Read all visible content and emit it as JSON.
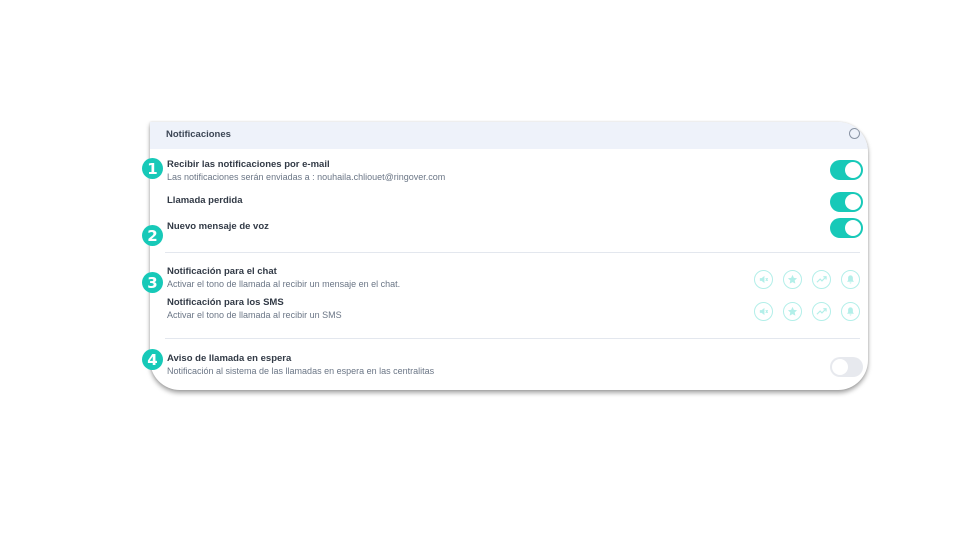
{
  "panel": {
    "title": "Notificaciones"
  },
  "email_notifications": {
    "title": "Recibir las notificaciones por e-mail",
    "subtitle": "Las notificaciones serán enviadas a : nouhaila.chliouet@ringover.com",
    "enabled": true
  },
  "missed_call": {
    "title": "Llamada perdida",
    "enabled": true
  },
  "voicemail": {
    "title": "Nuevo mensaje de voz",
    "enabled": true
  },
  "chat_notification": {
    "title": "Notificación para el chat",
    "subtitle": "Activar el tono de llamada al recibir un mensaje en el chat.",
    "icons": [
      "mute-icon",
      "star-icon",
      "trend-icon",
      "bell-icon"
    ]
  },
  "sms_notification": {
    "title": "Notificación para los SMS",
    "subtitle": "Activar el tono de llamada al recibir un SMS",
    "icons": [
      "mute-icon",
      "star-icon",
      "trend-icon",
      "bell-icon"
    ]
  },
  "call_waiting": {
    "title": "Aviso de llamada en espera",
    "subtitle": "Notificación al sistema de las llamadas en espera en las centralitas",
    "enabled": false
  },
  "badges": [
    "1",
    "2",
    "3",
    "4"
  ],
  "colors": {
    "accent": "#17c9b8",
    "icon_ring": "#b3efe9",
    "header_bg": "#eef2fa"
  }
}
